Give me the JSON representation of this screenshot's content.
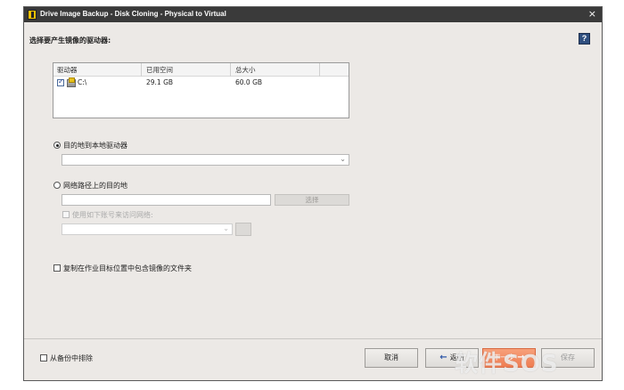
{
  "window": {
    "title": "Drive Image Backup - Disk Cloning - Physical to Virtual",
    "close_glyph": "×"
  },
  "page": {
    "heading": "选择要产生镜像的驱动器:",
    "help_glyph": "?"
  },
  "drive_table": {
    "columns": [
      "驱动器",
      "已用空间",
      "总大小"
    ],
    "rows": [
      {
        "checked": true,
        "drive": "C:\\",
        "used": "29.1 GB",
        "total": "60.0 GB"
      }
    ]
  },
  "destination": {
    "local_option": {
      "label": "目的地到本地驱动器",
      "selected": true,
      "combo_value": ""
    },
    "network_option": {
      "label": "网络路径上的目的地",
      "selected": false,
      "path_value": "",
      "browse_label": "选择",
      "use_account_label": "使用如下账号来访问网络:",
      "account_value": ""
    }
  },
  "copy_option": {
    "label": "复制在作业目标位置中包含镜像的文件夹",
    "checked": false
  },
  "footer": {
    "exclude_label": "从备份中排除",
    "exclude_checked": false,
    "cancel_label": "取消",
    "back_label": "返回",
    "next_label": "下一步",
    "save_label": "保存"
  },
  "watermark": "软件SOS",
  "icons": {
    "app": "app-logo-icon",
    "close": "close-icon",
    "help": "help-icon",
    "drive": "hard-drive-icon",
    "back": "arrow-left-icon",
    "next": "arrow-right-icon",
    "dropdown": "chevron-down-icon"
  },
  "colors": {
    "titlebar": "#3a3a3a",
    "accent": "#ef7d52",
    "help": "#2f4f7f"
  }
}
